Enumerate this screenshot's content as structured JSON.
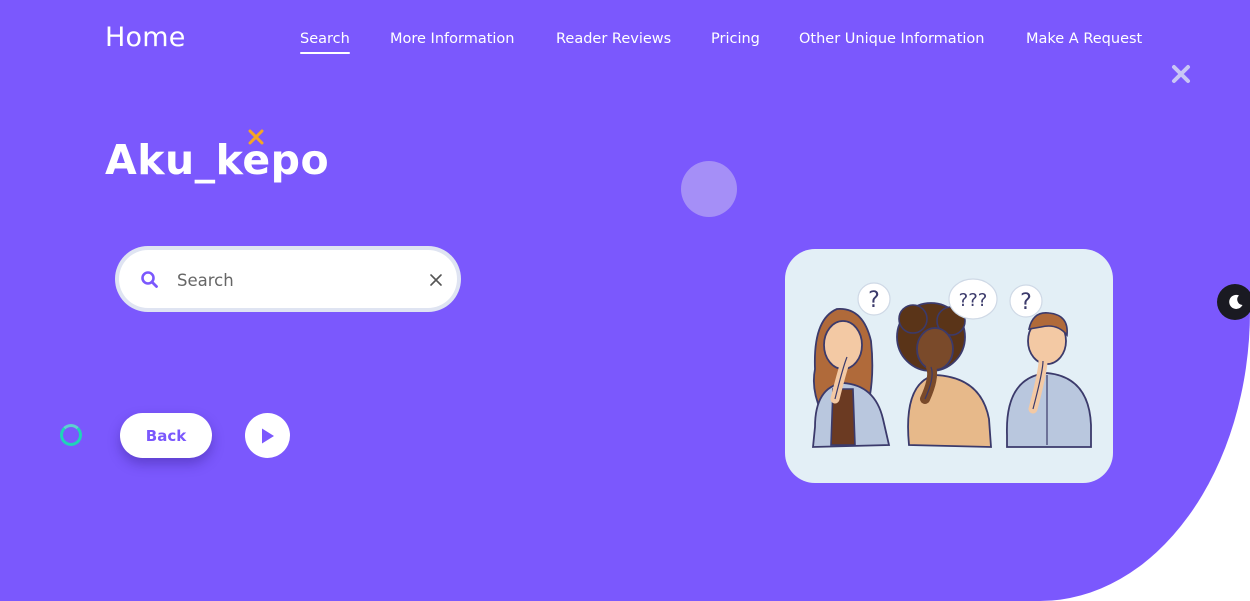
{
  "header": {
    "brand": "Home",
    "nav": [
      {
        "label": "Search",
        "active": true
      },
      {
        "label": "More Information",
        "active": false
      },
      {
        "label": "Reader Reviews",
        "active": false
      },
      {
        "label": "Pricing",
        "active": false
      },
      {
        "label": "Other Unique Information",
        "active": false
      },
      {
        "label": "Make A Request",
        "active": false
      }
    ]
  },
  "hero": {
    "logo_text": "Aku_kepo",
    "search": {
      "placeholder": "Search",
      "value": ""
    },
    "back_label": "Back",
    "illustration_marks": [
      "?",
      "???",
      "?"
    ]
  },
  "icons": [
    "close-icon",
    "star-icon",
    "search-icon",
    "clear-icon",
    "loading-spinner",
    "play-icon",
    "moon-icon"
  ],
  "colors": {
    "background": "#7b58fd",
    "accent_star": "#f5a623",
    "spinner": "#1fd3b8",
    "card": "#e3eff6"
  }
}
